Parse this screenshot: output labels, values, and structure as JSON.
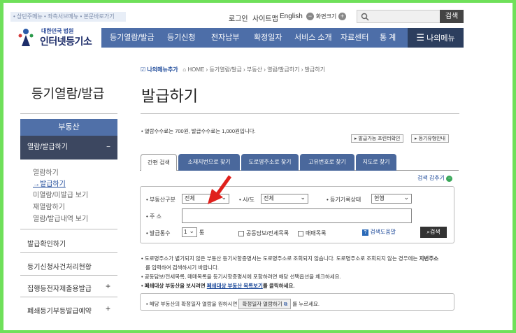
{
  "top": {
    "skip_links": "• 상단주메뉴 • 좌측서브메뉴 • 본문바로가기",
    "login": "로그인",
    "sitemap": "사이트맵",
    "english": "English",
    "zoom_label": "화면크기",
    "search_button": "검색"
  },
  "logo": {
    "sub": "대한민국 법원",
    "main": "인터넷등기소"
  },
  "gnb": [
    "등기열람/발급",
    "등기신청",
    "전자납부",
    "확정일자",
    "서비스 소개",
    "자료센터",
    "통 계"
  ],
  "mymenu": "나의메뉴",
  "breadcrumb": {
    "add": "나의메뉴추가",
    "path": "HOME › 등기열람/발급 › 부동산 › 열람/발급하기 › 발급하기"
  },
  "sidebar": {
    "title": "등기열람/발급",
    "section": "부동산",
    "active": "열람/발급하기",
    "subs": [
      "열람하기",
      "발급하기",
      "미열람/미발급 보기",
      "재열람하기",
      "열람/발급내역 보기"
    ],
    "items": [
      "발급확인하기",
      "등기신청사건처리현황",
      "집행등전자제출용발급",
      "폐쇄등기부등발급예약"
    ]
  },
  "page_title": "발급하기",
  "fee_info": "• 열람수수료는 700원, 발급수수료는 1,000원입니다.",
  "action_buttons": [
    "발급가능 프린터확인",
    "등기유형안내"
  ],
  "tabs": [
    "간편 검색",
    "소재지번으로 찾기",
    "도로명주소로 찾기",
    "고유번호로 찾기",
    "지도로 찾기"
  ],
  "search_toggle": "검색 감추기",
  "form": {
    "realestate_type_label": "• 부동산구분",
    "realestate_type_value": "전체",
    "sido_label": "• 시/도",
    "sido_value": "전체",
    "record_status_label": "• 등기기록상태",
    "record_status_value": "현행",
    "address_label": "• 주 소",
    "address_value": "",
    "copies_label": "• 발급통수",
    "copies_value": "1",
    "copies_unit": "통",
    "check1": "공동담보/전세목록",
    "check2": "매매목록",
    "help_button": "검색도움말",
    "search_button": "검색"
  },
  "notices": [
    "• 도로명주소가 별기되지 않은 부동산 등기사항증명서는 도로명주소로 조회되지 않습니다. 도로명주소로 조회되지 않는 경우에는",
    "지번주소",
    "를 입력하여 검색하시기 바랍니다.",
    "• 공동담보/전세목록, 매매목록을 등기사항증명서에 포함하려면 해당 선택옵션을 체크하세요.",
    "• 폐쇄대상 부동산을 보시려면",
    "폐쇄대상 부동산 목록보기",
    "를 클릭하세요."
  ],
  "bottom_note": {
    "prefix": "• 해당 부동산의 확정일자 열람을 원하시면",
    "button": "확정일자 열람하기",
    "suffix": "를 누르세요."
  },
  "colors": {
    "frame": "#6fe05a",
    "nav": "#4d6ea8",
    "nav_dark": "#2c3e5e",
    "sidebar_active": "#3c4760",
    "arrow": "#e0201c"
  }
}
